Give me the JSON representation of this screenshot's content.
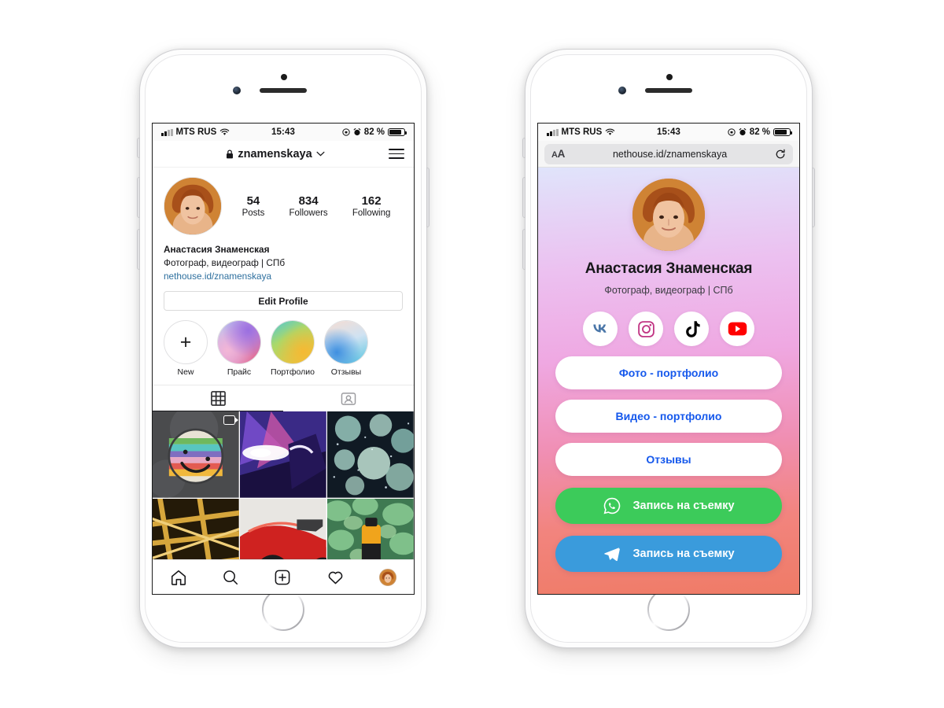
{
  "status_bar": {
    "carrier": "MTS RUS",
    "time": "15:43",
    "battery": "82 %",
    "wifi_icon": "wifi-icon",
    "signal_icon": "signal-bars-icon",
    "alarm_icon": "alarm-clock-icon",
    "lock_rotation_icon": "rotation-lock-icon"
  },
  "instagram": {
    "header": {
      "lock_icon": "lock-icon",
      "username": "znamenskaya",
      "chevron_icon": "chevron-down-icon",
      "menu_icon": "hamburger-menu-icon"
    },
    "stats": [
      {
        "num": "54",
        "label": "Posts"
      },
      {
        "num": "834",
        "label": "Followers"
      },
      {
        "num": "162",
        "label": "Following"
      }
    ],
    "bio": {
      "name": "Анастасия Знаменская",
      "description": "Фотограф, видеограф | СПб",
      "link": "nethouse.id/znamenskaya",
      "link_color": "#2d6f9e"
    },
    "edit_profile_label": "Edit Profile",
    "highlights": [
      {
        "label": "New",
        "type": "new",
        "icon": "plus-icon"
      },
      {
        "label": "Прайс",
        "type": "cover"
      },
      {
        "label": "Портфолио",
        "type": "cover"
      },
      {
        "label": "Отзывы",
        "type": "cover"
      }
    ],
    "tabs": [
      {
        "name": "grid",
        "icon": "grid-icon",
        "active": true
      },
      {
        "name": "tagged",
        "icon": "tagged-person-icon",
        "active": false
      }
    ],
    "grid_posts": [
      {
        "name": "smiley-manhole-photo",
        "has_reel_badge": true
      },
      {
        "name": "neon-light-painting-photo",
        "has_reel_badge": false
      },
      {
        "name": "frozen-bubbles-photo",
        "has_reel_badge": false
      },
      {
        "name": "golden-beams-photo",
        "has_reel_badge": false
      },
      {
        "name": "red-sportscar-photo",
        "has_reel_badge": false
      },
      {
        "name": "juice-bottle-greens-photo",
        "has_reel_badge": false
      }
    ],
    "bottom_nav": [
      {
        "name": "home",
        "icon": "home-icon"
      },
      {
        "name": "search",
        "icon": "search-icon"
      },
      {
        "name": "add",
        "icon": "plus-square-icon"
      },
      {
        "name": "activity",
        "icon": "heart-icon"
      },
      {
        "name": "profile",
        "icon": "avatar-icon"
      }
    ]
  },
  "safari": {
    "aa_button": "AA",
    "url": "nethouse.id/znamenskaya",
    "reload_icon": "reload-icon"
  },
  "landing": {
    "avatar_icon": "profile-portrait",
    "name": "Анастасия Знаменская",
    "subtitle": "Фотограф, видеограф | СПб",
    "socials": [
      {
        "name": "vk",
        "label": "VK",
        "color": "#4a76a8"
      },
      {
        "name": "instagram",
        "label": "Instagram",
        "color": "#c13584"
      },
      {
        "name": "tiktok",
        "label": "TikTok",
        "color": "#010101"
      },
      {
        "name": "youtube",
        "label": "YouTube",
        "color": "#ff0000"
      }
    ],
    "link_buttons": [
      {
        "label": "Фото - портфолио"
      },
      {
        "label": "Видео - портфолио"
      },
      {
        "label": "Отзывы"
      }
    ],
    "cta_buttons": [
      {
        "label": "Запись на съемку",
        "icon": "whatsapp-icon",
        "color": "#3ccb5a"
      },
      {
        "label": "Запись на съемку",
        "icon": "telegram-icon",
        "color": "#3a9bdc"
      }
    ],
    "text_color": "#1558ec",
    "gradient_top": "#dfe3fb",
    "gradient_mid": "#eeb4ee",
    "gradient_bottom": "#f07a6a"
  }
}
